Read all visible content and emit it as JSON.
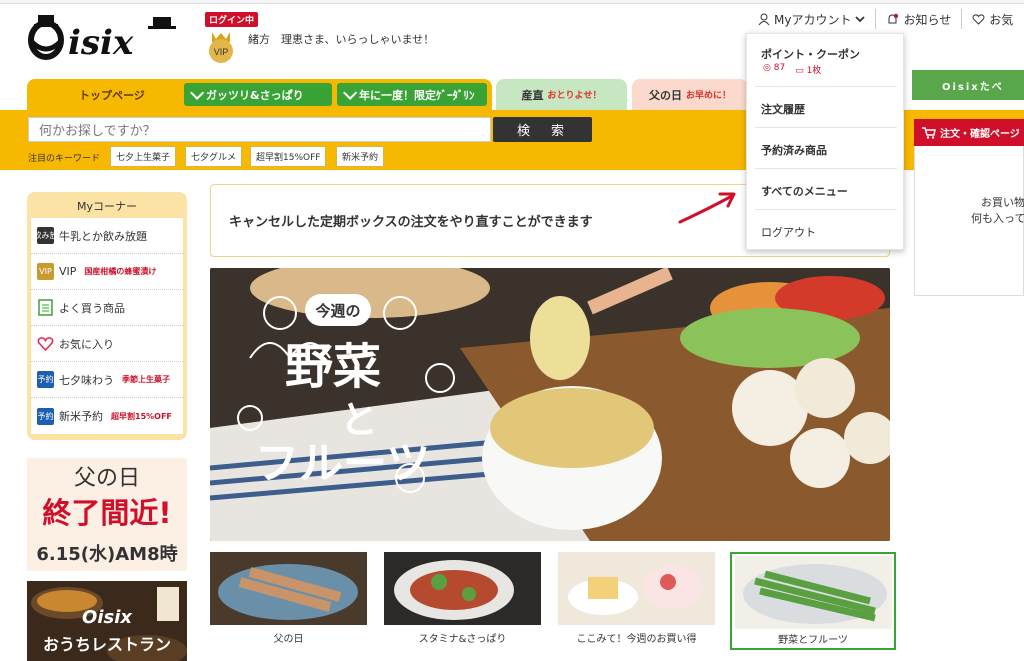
{
  "header": {
    "logo_text": "Oisix",
    "login_badge": "ログイン中",
    "vip_label": "VIP",
    "greeting": "緒方　理恵さま、いらっしゃいませ！",
    "account_menu": "Myアカウント",
    "notifications": "お知らせ",
    "favorites": "お気"
  },
  "dropdown": {
    "points_coupons": "ポイント・クーポン",
    "points_value": "87",
    "coupon_value": "1枚",
    "order_history": "注文履歴",
    "reserved_items": "予約済み商品",
    "all_menu": "すべてのメニュー",
    "logout": "ログアウト"
  },
  "nav": {
    "top_page": "トップページ",
    "hearty": "ガッツリ&さっぱり",
    "limited": "年に一度！限定ｹﾞｰﾀﾞﾘﾝ",
    "sanchoku": "産直",
    "sanchoku_sub": "おとりよせ！",
    "fathers_day": "父の日",
    "fathers_day_sub": "お早めに！"
  },
  "search": {
    "placeholder": "何かお探しですか？",
    "button": "検　索",
    "keywords_label": "注目のキーワード",
    "keywords": [
      "七夕上生菓子",
      "七夕グルメ",
      "超早割15%OFF",
      "新米予約"
    ]
  },
  "my_corner": {
    "title": "Myコーナー",
    "items": [
      {
        "label": "牛乳とか飲み放題",
        "tag": ""
      },
      {
        "label": "VIP",
        "tag": "国産柑橘の蜂蜜漬け"
      },
      {
        "label": "よく買う商品",
        "tag": ""
      },
      {
        "label": "お気に入り",
        "tag": ""
      },
      {
        "label": "七夕味わう",
        "tag": "季節上生菓子"
      },
      {
        "label": "新米予約",
        "tag": "超早割15%OFF"
      }
    ],
    "icon_labels": [
      "飲み放",
      "VIP",
      "予約",
      "予約"
    ]
  },
  "banners": {
    "father_line1": "父の日",
    "father_line2": "終了間近!",
    "father_line3": "6.15(水)AM8時",
    "restaurant_line1": "Oisix",
    "restaurant_line2": "おうちレストラン"
  },
  "notice": "キャンセルした定期ボックスの注文をやり直すことができます",
  "hero": {
    "line_small": "今週の",
    "line1": "野菜",
    "line2": "と",
    "line3": "フルーツ"
  },
  "thumbs": [
    {
      "caption": "父の日"
    },
    {
      "caption": "スタミナ&さっぱり"
    },
    {
      "caption": "ここみて！今週のお買い得"
    },
    {
      "caption": "野菜とフルーツ"
    }
  ],
  "right": {
    "oisix_tabe": "Oisixたべ",
    "cart_head": "注文・確認ページ",
    "cart_empty1": "お買い物",
    "cart_empty2": "何も入って"
  },
  "colors": {
    "accent_yellow": "#f6b800",
    "green": "#3aa335",
    "red": "#d0102a"
  }
}
